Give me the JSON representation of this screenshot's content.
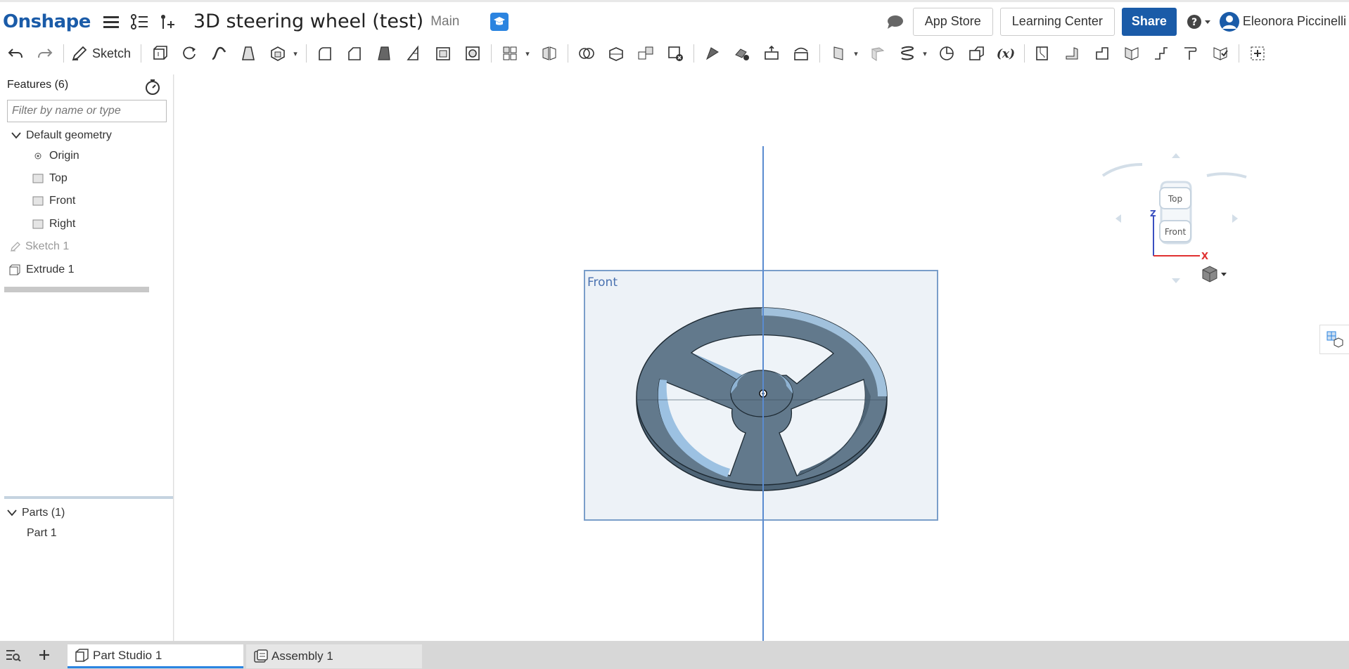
{
  "app": {
    "logo": "Onshape"
  },
  "document": {
    "title": "3D steering wheel (test)",
    "branch": "Main"
  },
  "header": {
    "app_store": "App Store",
    "learning_center": "Learning Center",
    "share": "Share",
    "user_name": "Eleonora Piccinelli"
  },
  "toolbar": {
    "sketch_label": "Sketch"
  },
  "features": {
    "heading": "Features (6)",
    "filter_placeholder": "Filter by name or type",
    "default_geometry": "Default geometry",
    "items": [
      {
        "label": "Origin"
      },
      {
        "label": "Top"
      },
      {
        "label": "Front"
      },
      {
        "label": "Right"
      },
      {
        "label": "Sketch 1"
      },
      {
        "label": "Extrude 1"
      }
    ]
  },
  "parts": {
    "heading": "Parts (1)",
    "items": [
      {
        "label": "Part 1"
      }
    ]
  },
  "viewport": {
    "plane_label": "Front",
    "view_cube": {
      "top": "Top",
      "front": "Front",
      "axis_z": "Z",
      "axis_x": "X"
    }
  },
  "tabs": [
    {
      "label": "Part Studio 1",
      "active": true
    },
    {
      "label": "Assembly 1",
      "active": false
    }
  ],
  "colors": {
    "brand": "#1a5ba8",
    "accent": "#2b84e0",
    "part": "#5f7a8e",
    "plane": "#e9eff5"
  }
}
